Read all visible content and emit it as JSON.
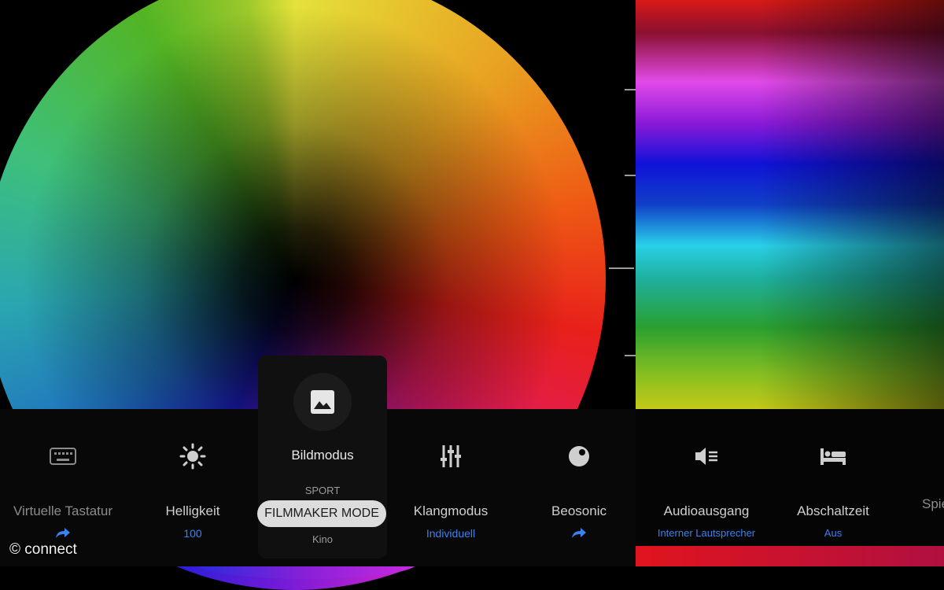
{
  "watermark": "© connect",
  "menu": {
    "items": [
      {
        "label": "Virtuelle Tastatur",
        "value": "",
        "icon": "keyboard-icon"
      },
      {
        "label": "Helligkeit",
        "value": "100",
        "icon": "sun-icon"
      },
      {
        "label": "Klangmodus",
        "value": "Individuell",
        "icon": "equalizer-icon"
      },
      {
        "label": "Beosonic",
        "value": "",
        "icon": "beosonic-icon"
      },
      {
        "label": "Audioausgang",
        "value": "Interner Lautsprecher",
        "icon": "speaker-icon"
      },
      {
        "label": "Abschaltzeit",
        "value": "Aus",
        "icon": "sleep-bed-icon"
      },
      {
        "label": "Spie",
        "value": "",
        "icon": ""
      }
    ],
    "active": {
      "label": "Bildmodus",
      "icon": "picture-icon",
      "options": {
        "above": "SPORT",
        "selected": "FILMMAKER MODE",
        "below": "Kino"
      }
    }
  },
  "colors": {
    "accent": "#3a82f0",
    "selected_pill": "#dcdcdc",
    "panel": "#101010"
  }
}
